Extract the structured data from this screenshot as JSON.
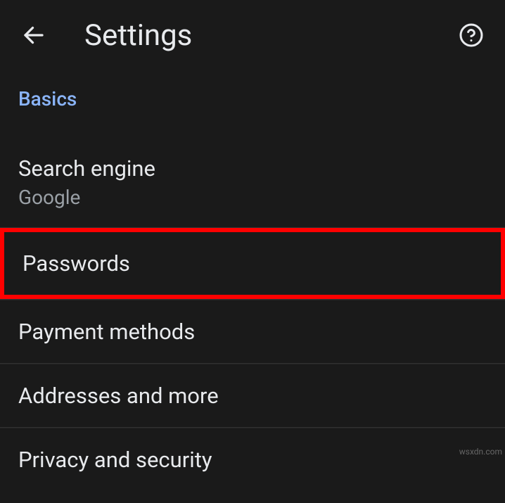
{
  "header": {
    "title": "Settings"
  },
  "section": {
    "label": "Basics"
  },
  "items": {
    "searchEngine": {
      "title": "Search engine",
      "subtitle": "Google"
    },
    "passwords": {
      "title": "Passwords"
    },
    "paymentMethods": {
      "title": "Payment methods"
    },
    "addresses": {
      "title": "Addresses and more"
    },
    "privacy": {
      "title": "Privacy and security"
    }
  },
  "watermark": "wsxdn.com"
}
